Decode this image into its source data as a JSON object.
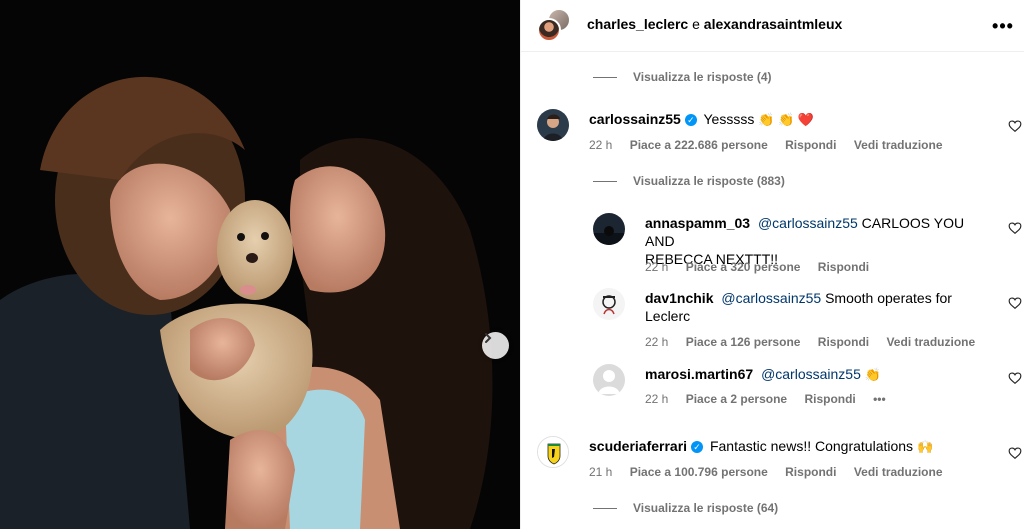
{
  "post": {
    "author_1": "charles_leclerc",
    "connector": "e",
    "author_2": "alexandrasaintmleux",
    "more_icon": "more-horizontal-icon"
  },
  "thread": {
    "view_replies_1": "Visualizza le risposte (4)",
    "view_replies_2": "Visualizza le risposte (883)",
    "view_replies_3": "Visualizza le risposte (64)"
  },
  "comments": {
    "carlos": {
      "username": "carlossainz55",
      "verified": true,
      "text": "Yesssss",
      "emoji": "👏 👏 ❤️",
      "time": "22 h",
      "likes": "Piace a 222.686 persone",
      "reply": "Rispondi",
      "translate": "Vedi traduzione"
    },
    "anna": {
      "username": "annaspamm_03",
      "mention": "@carlossainz55",
      "text": "CARLOOS YOU AND",
      "text_2": "REBECCA NEXTTT!!",
      "time": "22 h",
      "likes": "Piace a 320 persone",
      "reply": "Rispondi"
    },
    "dav": {
      "username": "dav1nchik",
      "mention": "@carlossainz55",
      "text": "Smooth operates for",
      "text_2": "Leclerc",
      "time": "22 h",
      "likes": "Piace a 126 persone",
      "reply": "Rispondi",
      "translate": "Vedi traduzione"
    },
    "marosi": {
      "username": "marosi.martin67",
      "mention": "@carlossainz55",
      "emoji": "👏",
      "time": "22 h",
      "likes": "Piace a 2 persone",
      "reply": "Rispondi",
      "more": "•••"
    },
    "ferrari": {
      "username": "scuderiaferrari",
      "verified": true,
      "text": "Fantastic news!! Congratulations",
      "emoji": "🙌",
      "time": "21 h",
      "likes": "Piace a 100.796 persone",
      "reply": "Rispondi",
      "translate": "Vedi traduzione"
    }
  },
  "colors": {
    "link": "#00376b",
    "meta": "#737373",
    "verified": "#0095f6"
  }
}
